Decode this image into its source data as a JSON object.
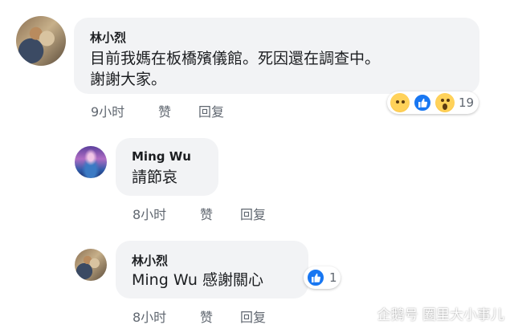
{
  "comments": [
    {
      "author": "林小烈",
      "lines": [
        "目前我媽在板橋殯儀館。死因還在調查中。",
        "謝謝大家。"
      ],
      "time": "9小时",
      "like_label": "赞",
      "reply_label": "回复",
      "reactions": [
        "sad",
        "like",
        "wow"
      ],
      "reaction_count": "19"
    },
    {
      "author": "Ming Wu",
      "lines": [
        "請節哀"
      ],
      "time": "8小时",
      "like_label": "赞",
      "reply_label": "回复"
    },
    {
      "author": "林小烈",
      "lines": [
        "Ming Wu 感謝關心"
      ],
      "time": "8小时",
      "like_label": "赞",
      "reply_label": "回复",
      "reactions": [
        "like"
      ],
      "reaction_count": "1"
    }
  ],
  "watermark": "企鹅号 圈里大小事儿",
  "colors": {
    "bubble": "#f2f3f5",
    "like_blue": "#1877f2",
    "meta_text": "#606770"
  }
}
